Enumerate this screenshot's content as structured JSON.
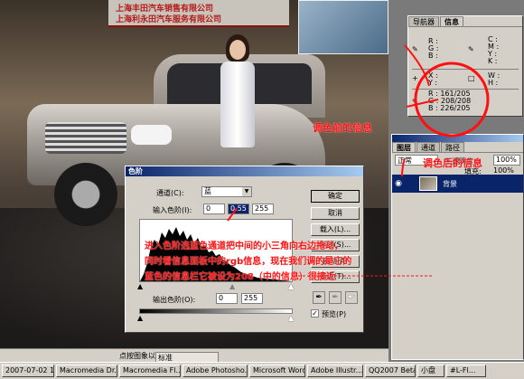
{
  "photo": {
    "sign_line1": "上海丰田汽车销售有限公司",
    "sign_line2": "上海利永田汽车服务有限公司"
  },
  "navigator": {
    "tabs": [
      "导航器",
      "信息"
    ],
    "labels": {
      "rgb": "R :\nG :\nB :",
      "cmyk": "C :\nM :\nY :\nK :",
      "xy": "X :\nY :",
      "wh": "W :\nH :"
    },
    "readout": "R : 161/205\nG : 208/208\nB : 226/205"
  },
  "layers": {
    "tabs": [
      "图层",
      "通道",
      "路径"
    ],
    "blend_mode": "正常",
    "opacity_label": "不透明度:",
    "opacity_value": "100%",
    "fill_label": "填充:",
    "fill_value": "100%",
    "layer_name": "背景"
  },
  "levels_dialog": {
    "title": "色阶",
    "channel_label": "通道(C):",
    "channel_value": "蓝",
    "input_label": "输入色阶(I):",
    "input_black": "0",
    "input_gamma": "0.55",
    "input_white": "255",
    "output_label": "输出色阶(O):",
    "output_black": "0",
    "output_white": "255",
    "buttons": {
      "ok": "确定",
      "cancel": "取消",
      "load": "载入(L)...",
      "save": "存储(S)...",
      "auto": "自动(A)",
      "options": "选项(T)..."
    },
    "preview_label": "预览(P)",
    "preview_checked": true
  },
  "annotations": {
    "before": "调色前的信息",
    "after": "调色后的信息",
    "body_line1": "进入色阶选蓝色通道把中间的小三角向右边拖动，",
    "body_line2": "同时看信息面板中的rgb信息，现在我们调的是它的",
    "body_line3": "蓝色的信息栏它被设为208（中的信息）很接近",
    "color": "#ff1010"
  },
  "status": {
    "hint": "点按图象以",
    "ime_label": "标准"
  },
  "taskbar": {
    "items": [
      "2007-07-02 18...",
      "Macromedia Dr...",
      "Macromedia Fl...",
      "Adobe Photosho...",
      "Microsoft Word",
      "Adobe Illustr...",
      "QQ2007 Beta...",
      "小盘",
      "#L-Fl..."
    ]
  }
}
